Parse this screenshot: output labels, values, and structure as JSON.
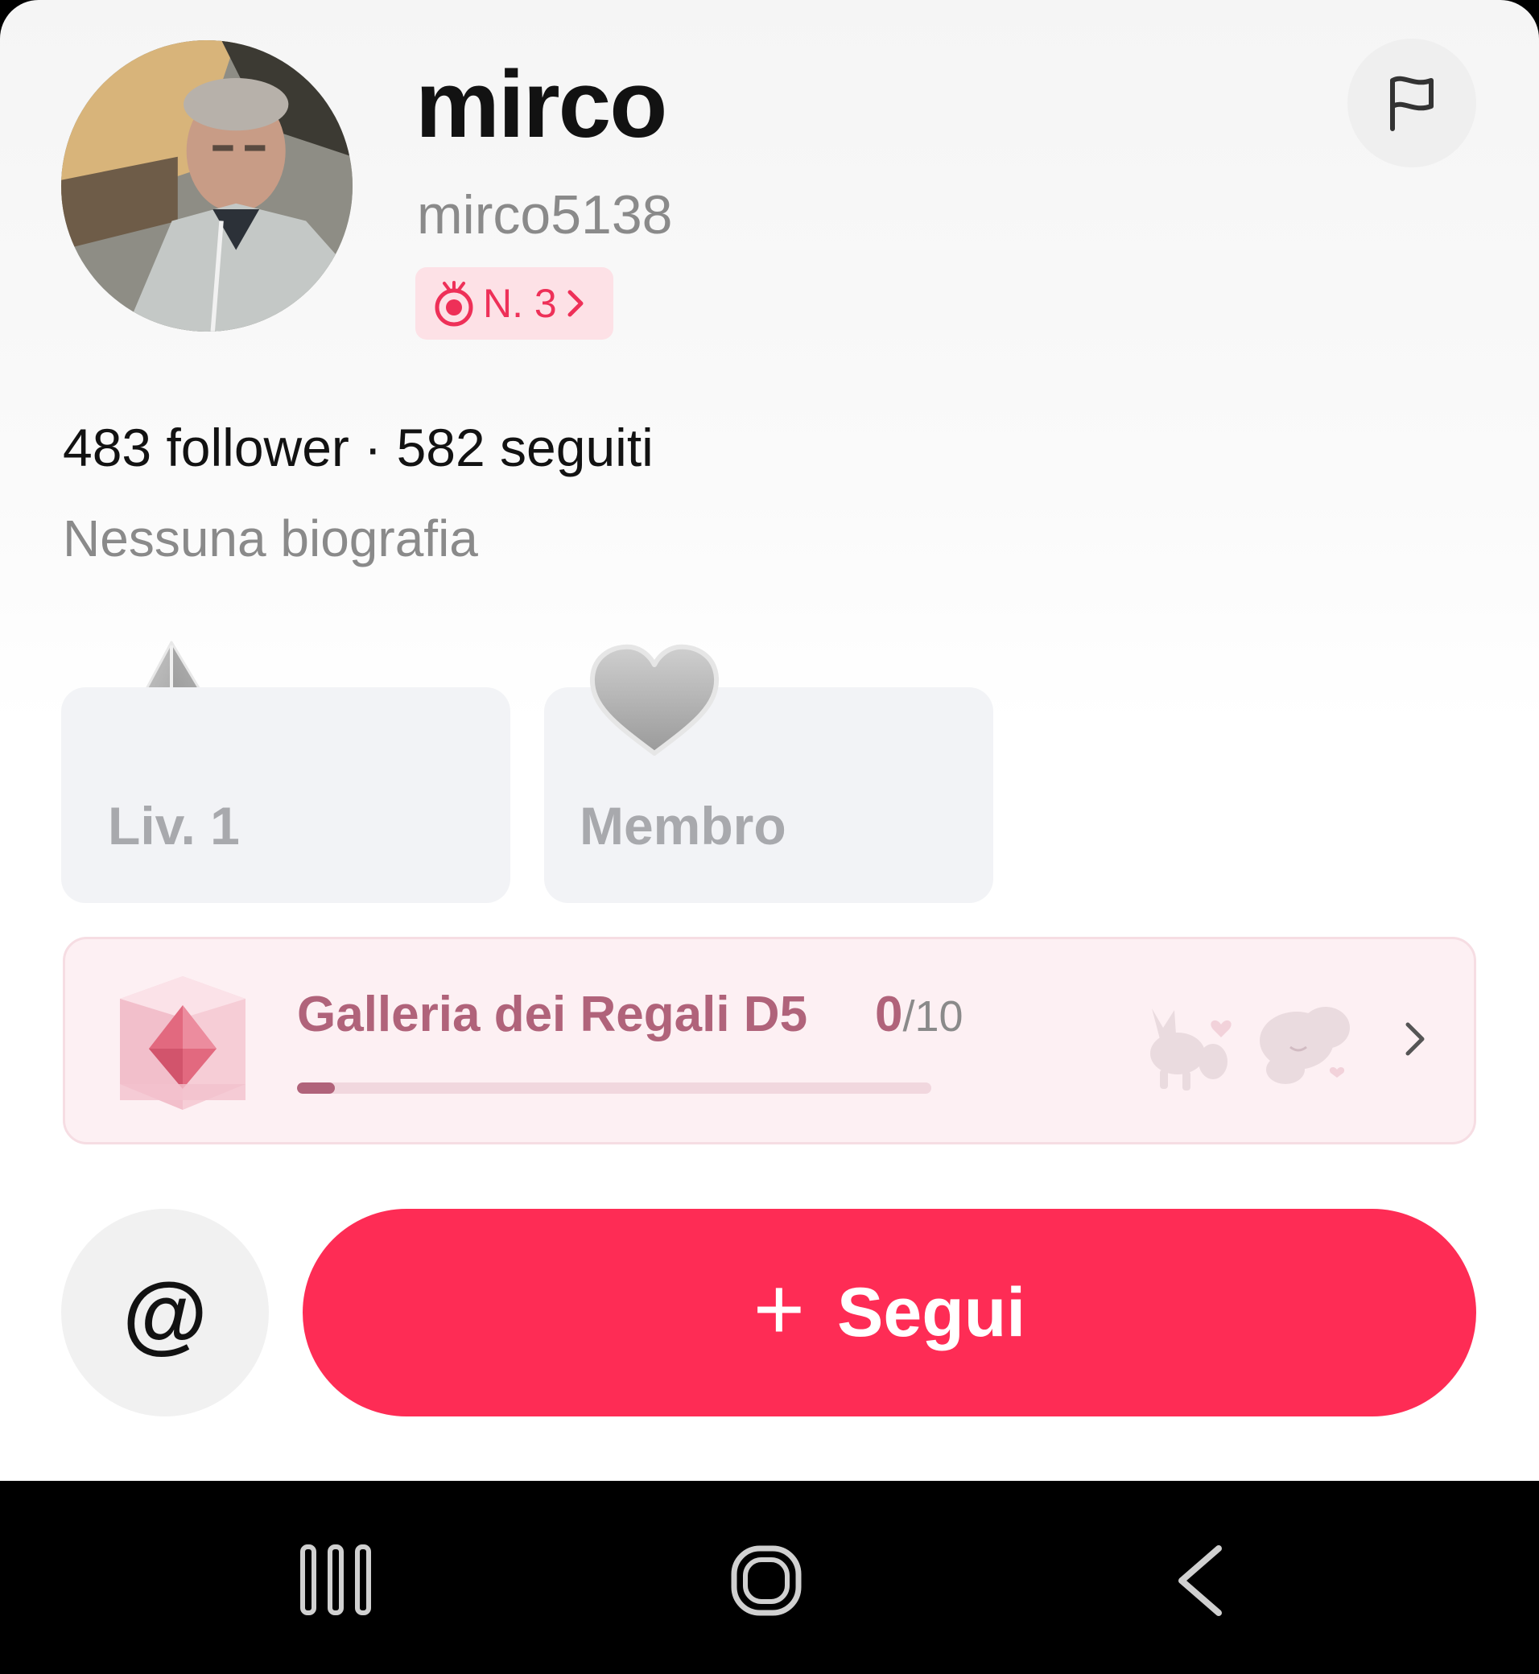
{
  "profile": {
    "display_name": "mirco",
    "handle": "mirco5138",
    "rank_badge": "N. 3",
    "followers_count": "483",
    "followers_label": "follower",
    "separator": "·",
    "following_count": "582",
    "following_label": "seguiti",
    "bio": "Nessuna biografia"
  },
  "badges": {
    "level_label": "Liv. 1",
    "member_label": "Membro"
  },
  "gift_gallery": {
    "title": "Galleria dei Regali D5",
    "collected": "0",
    "separator": "/",
    "total": "10",
    "progress_fraction": 0.06
  },
  "actions": {
    "mention_label": "@",
    "follow_plus": "+",
    "follow_label": "Segui"
  },
  "icons": {
    "report": "flag-icon",
    "rank": "stopwatch-icon",
    "level": "paper-plane-icon",
    "member": "heart-icon",
    "gift": "gem-cube-icon",
    "nav_recent": "recent-apps-icon",
    "nav_home": "home-icon",
    "nav_back": "back-icon"
  },
  "colors": {
    "accent": "#fe2c55",
    "rank_text": "#ee3058",
    "gift_text": "#b0637a"
  }
}
